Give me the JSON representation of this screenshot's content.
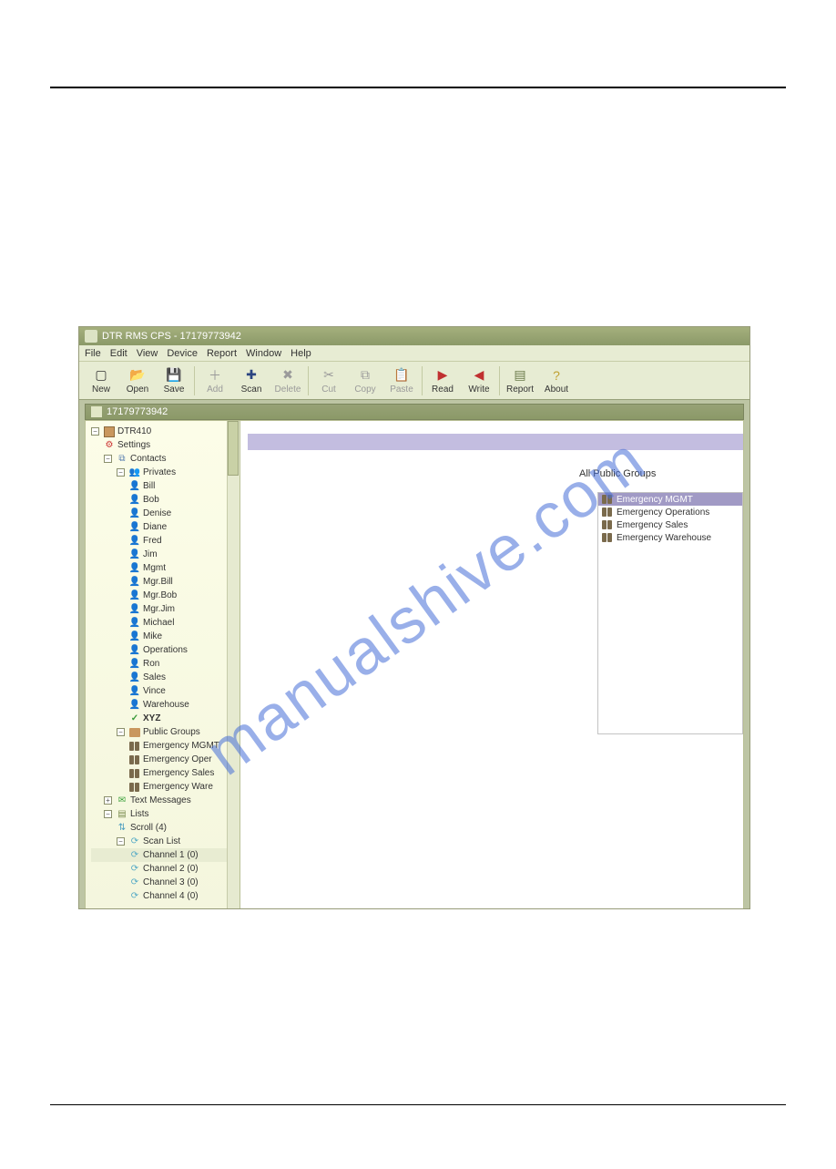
{
  "titlebar": {
    "text": "DTR RMS CPS - 17179773942"
  },
  "menu": {
    "items": [
      "File",
      "Edit",
      "View",
      "Device",
      "Report",
      "Window",
      "Help"
    ]
  },
  "toolbar": {
    "new": "New",
    "open": "Open",
    "save": "Save",
    "add": "Add",
    "scan": "Scan",
    "delete": "Delete",
    "cut": "Cut",
    "copy": "Copy",
    "paste": "Paste",
    "read": "Read",
    "write": "Write",
    "report": "Report",
    "about": "About"
  },
  "child_title": "17179773942",
  "tree": {
    "root": "DTR410",
    "settings": "Settings",
    "contacts": "Contacts",
    "privates_label": "Privates",
    "privates": [
      "Bill",
      "Bob",
      "Denise",
      "Diane",
      "Fred",
      "Jim",
      "Mgmt",
      "Mgr.Bill",
      "Mgr.Bob",
      "Mgr.Jim",
      "Michael",
      "Mike",
      "Operations",
      "Ron",
      "Sales",
      "Vince",
      "Warehouse"
    ],
    "xyz": "XYZ",
    "public_groups_label": "Public Groups",
    "public_groups": [
      "Emergency MGMT",
      "Emergency Oper",
      "Emergency Sales",
      "Emergency Ware"
    ],
    "text_messages": "Text Messages",
    "lists": "Lists",
    "scroll": "Scroll (4)",
    "scan_list": "Scan List",
    "channels": [
      "Channel 1 (0)",
      "Channel 2 (0)",
      "Channel 3 (0)",
      "Channel 4 (0)"
    ]
  },
  "content": {
    "groups_header": "All Public Groups",
    "groups": [
      "Emergency MGMT",
      "Emergency Operations",
      "Emergency Sales",
      "Emergency Warehouse"
    ],
    "selected_group_index": 0
  },
  "watermark": "manualshive.com"
}
